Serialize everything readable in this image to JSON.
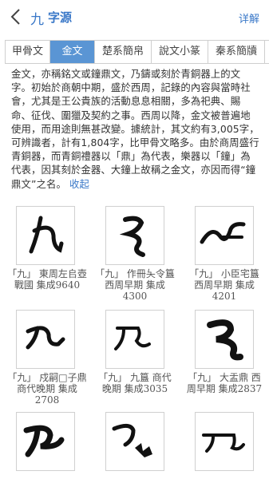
{
  "header": {
    "char": "九",
    "title": "字源",
    "detail_label": "详解"
  },
  "tabs": [
    {
      "label": "甲骨文",
      "active": false
    },
    {
      "label": "金文",
      "active": true
    },
    {
      "label": "楚系簡帛",
      "active": false
    },
    {
      "label": "說文小篆",
      "active": false
    },
    {
      "label": "秦系簡牘",
      "active": false
    }
  ],
  "description": {
    "text": "金文，亦稱銘文或鐘鼎文，乃鑄或刻於青銅器上的文字。初始於商朝中期，盛於西周，記錄的內容與當時社會，尤其是王公貴族的活動息息相關，多為祀典、賜命、征伐、圍獵及契約之事。西周以降，金文被普遍地使用，而用途則無甚改變。據統計，其文約有3,005字，可辨識者，計有1,804字，比甲骨文略多。由於商周盛行青銅器，而青銅禮器以「鼎」為代表，樂器以「鐘」為代表，因其刻於金器、大鐘上故稱之金文，亦因而得“鐘鼎文”之名。",
    "collapse_label": "收起"
  },
  "glyphs": [
    {
      "caption": "「九」 東周左𠂤壺 戰國 集成9640",
      "icon": "jiu-glyph-1"
    },
    {
      "caption": "「九」 作冊夨令簋 西周早期 集成4300",
      "icon": "jiu-glyph-2"
    },
    {
      "caption": "「九」 小臣宅簋 西周早期 集成4201",
      "icon": "jiu-glyph-3"
    },
    {
      "caption": "「九」 戍嗣□子鼎 商代晚期 集成2708",
      "icon": "jiu-glyph-4"
    },
    {
      "caption": "「九」 九簋 商代晚期 集成3035",
      "icon": "jiu-glyph-5"
    },
    {
      "caption": "「九」 大盂鼎 西周早期 集成2837",
      "icon": "jiu-glyph-6"
    },
    {
      "caption": "",
      "icon": "jiu-glyph-7"
    },
    {
      "caption": "",
      "icon": "jiu-glyph-8"
    },
    {
      "caption": "",
      "icon": "jiu-glyph-9"
    }
  ]
}
